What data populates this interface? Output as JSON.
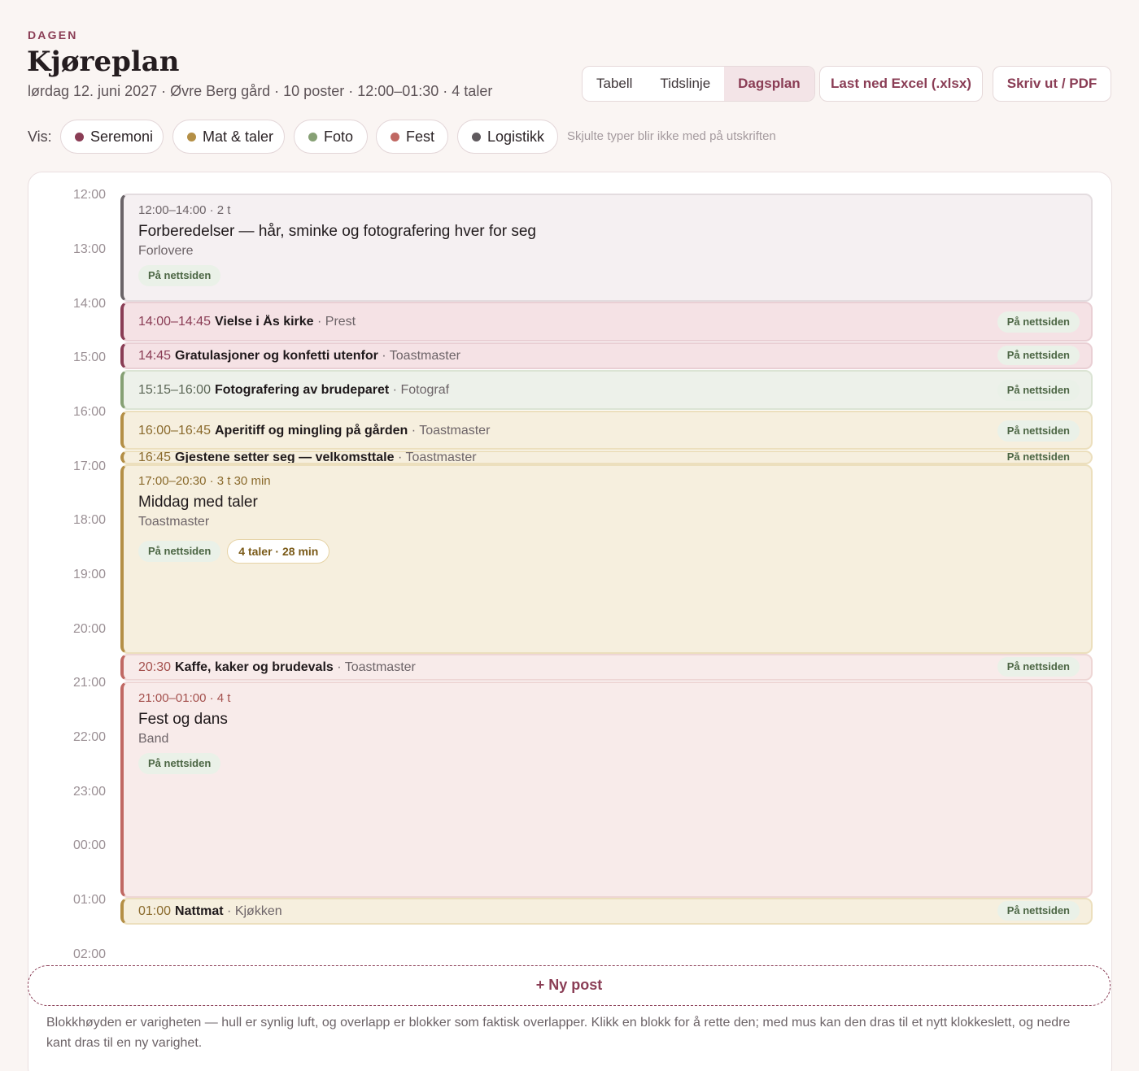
{
  "header": {
    "eyebrow": "DAGEN",
    "title": "Kjøreplan",
    "subtitle": "lørdag 12. juni 2027 · Øvre Berg gård · 10 poster · 12:00–01:30 · 4 taler"
  },
  "view_tabs": [
    {
      "label": "Tabell",
      "active": false
    },
    {
      "label": "Tidslinje",
      "active": false
    },
    {
      "label": "Dagsplan",
      "active": true
    }
  ],
  "actions": {
    "excel": "Last ned Excel (.xlsx)",
    "print": "Skriv ut / PDF"
  },
  "filter": {
    "label": "Vis:",
    "chips": [
      {
        "label": "Seremoni",
        "color": "#8a3d55"
      },
      {
        "label": "Mat & taler",
        "color": "#b48f46"
      },
      {
        "label": "Foto",
        "color": "#86a074"
      },
      {
        "label": "Fest",
        "color": "#c06863"
      },
      {
        "label": "Logistikk",
        "color": "#5f5a5e"
      }
    ],
    "hint": "Skjulte typer blir ikke med på utskriften"
  },
  "hours": [
    "12:00",
    "13:00",
    "14:00",
    "15:00",
    "16:00",
    "17:00",
    "18:00",
    "19:00",
    "20:00",
    "21:00",
    "22:00",
    "23:00",
    "00:00",
    "01:00",
    "02:00"
  ],
  "web_badge": "På nettsiden",
  "events": [
    {
      "meta": "12:00–14:00 · 2 t",
      "title": "Forberedelser — hår, sminke og fotografering hver for seg",
      "who": "Forlovere"
    },
    {
      "time": "14:00–14:45",
      "title": "Vielse i Ås kirke",
      "sep": " · ",
      "who": "Prest"
    },
    {
      "time": "14:45",
      "title": "Gratulasjoner og konfetti utenfor",
      "sep": " · ",
      "who": "Toastmaster"
    },
    {
      "time": "15:15–16:00",
      "title": "Fotografering av brudeparet",
      "sep": " · ",
      "who": "Fotograf"
    },
    {
      "time": "16:00–16:45",
      "title": "Aperitiff og mingling på gården",
      "sep": " · ",
      "who": "Toastmaster"
    },
    {
      "time": "16:45",
      "title": "Gjestene setter seg — velkomsttale",
      "sep": " · ",
      "who": "Toastmaster"
    },
    {
      "meta": "17:00–20:30 · 3 t 30 min",
      "title": "Middag med taler",
      "who": "Toastmaster",
      "speeches": "4 taler · 28 min"
    },
    {
      "time": "20:30",
      "title": "Kaffe, kaker og brudevals",
      "sep": " · ",
      "who": "Toastmaster"
    },
    {
      "meta": "21:00–01:00 · 4 t",
      "title": "Fest og dans",
      "who": "Band"
    },
    {
      "time": "01:00",
      "title": "Nattmat",
      "sep": " · ",
      "who": "Kjøkken"
    }
  ],
  "new_post": "+ Ny post",
  "footnote": "Blokkhøyden er varigheten — hull er synlig luft, og overlapp er blokker som faktisk overlapper. Klikk en blokk for å rette den; med mus kan den dras til et nytt klokkeslett, og nedre kant dras til en ny varighet."
}
